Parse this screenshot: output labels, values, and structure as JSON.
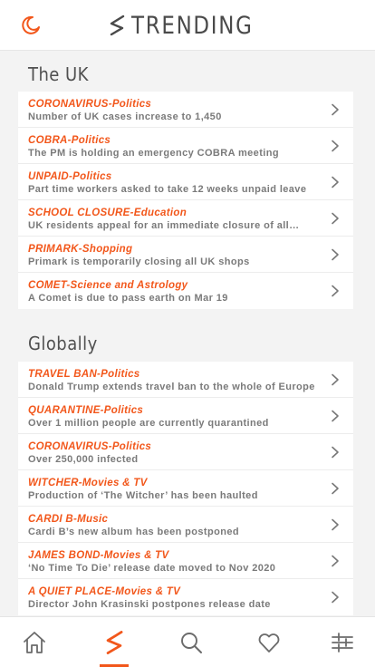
{
  "header": {
    "title": "TRENDING",
    "moon_icon": "moon-icon",
    "logo_icon": "trending-bolt-icon"
  },
  "colors": {
    "accent": "#f2571b",
    "text": "#7a7a7a",
    "icon": "#6b6b6b"
  },
  "sections": [
    {
      "title": "The UK",
      "items": [
        {
          "category": "CORONAVIRUS-Politics",
          "text": "Number of UK cases increase to 1,450"
        },
        {
          "category": "COBRA-Politics",
          "text": "The PM is holding an emergency COBRA meeting"
        },
        {
          "category": "UNPAID-Politics",
          "text": "Part time workers asked to take 12 weeks unpaid leave"
        },
        {
          "category": "SCHOOL CLOSURE-Education",
          "text": "UK residents appeal for an immediate closure of all…"
        },
        {
          "category": "PRIMARK-Shopping",
          "text": "Primark is temporarily closing all UK shops"
        },
        {
          "category": "COMET-Science and Astrology",
          "text": "A Comet is due to pass earth on Mar 19"
        }
      ]
    },
    {
      "title": "Globally",
      "items": [
        {
          "category": "TRAVEL BAN-Politics",
          "text": "Donald Trump extends travel ban to the whole of Europe"
        },
        {
          "category": "QUARANTINE-Politics",
          "text": "Over 1 million people are currently quarantined"
        },
        {
          "category": "CORONAVIRUS-Politics",
          "text": "Over 250,000 infected"
        },
        {
          "category": "WITCHER-Movies & TV",
          "text": "Production of ‘The Witcher’ has been haulted"
        },
        {
          "category": "CARDI B-Music",
          "text": "Cardi B’s new album has been postponed"
        },
        {
          "category": "JAMES BOND-Movies & TV",
          "text": "‘No Time To Die’ release date moved to Nov 2020"
        },
        {
          "category": "A QUIET PLACE-Movies & TV",
          "text": "Director John Krasinski postpones release date"
        }
      ]
    }
  ],
  "tabs": [
    {
      "name": "home-icon",
      "active": false
    },
    {
      "name": "trending-bolt-icon",
      "active": true
    },
    {
      "name": "search-icon",
      "active": false
    },
    {
      "name": "heart-icon",
      "active": false
    },
    {
      "name": "sliders-icon",
      "active": false
    }
  ]
}
